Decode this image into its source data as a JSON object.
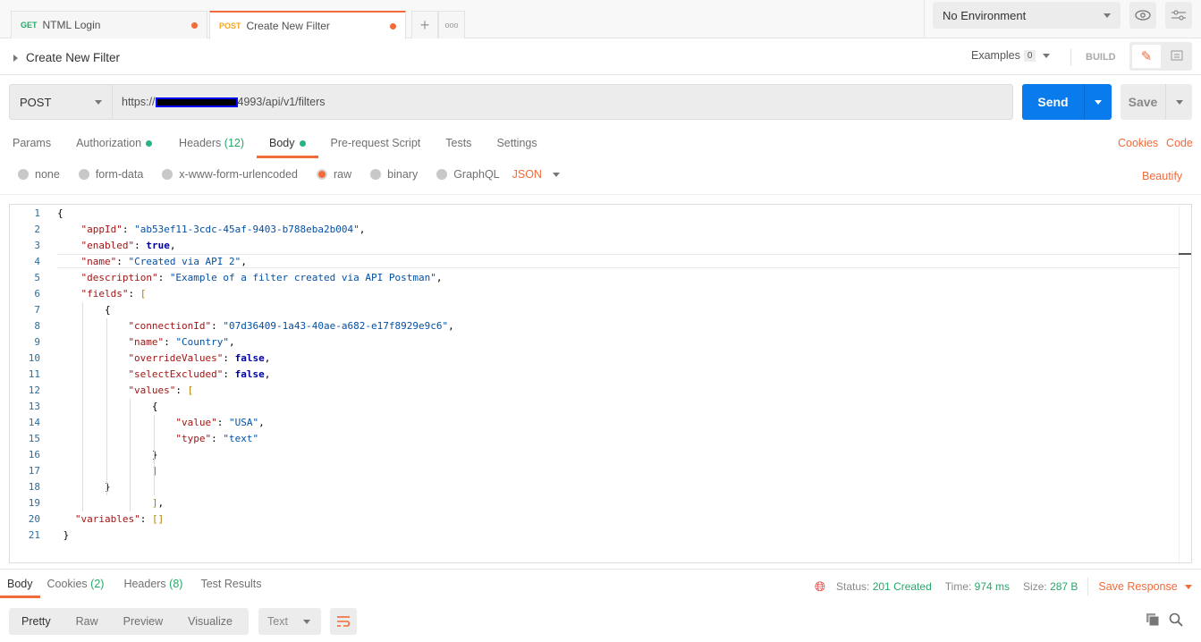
{
  "tabs": [
    {
      "method": "GET",
      "label": "NTML Login",
      "method_color": "#26a86a"
    },
    {
      "method": "POST",
      "label": "Create New Filter",
      "method_color": "#f5a623"
    }
  ],
  "environment": "No Environment",
  "request": {
    "title": "Create New Filter",
    "examples_label": "Examples",
    "examples_count": "0",
    "build_label": "BUILD",
    "method": "POST",
    "url_prefix": "https://",
    "url_suffix": "4993/api/v1/filters",
    "send_label": "Send",
    "save_label": "Save"
  },
  "req_tabs": [
    {
      "label": "Params"
    },
    {
      "label": "Authorization",
      "dot": true
    },
    {
      "label": "Headers",
      "count": "(12)"
    },
    {
      "label": "Body",
      "dot": true,
      "active": true
    },
    {
      "label": "Pre-request Script"
    },
    {
      "label": "Tests"
    },
    {
      "label": "Settings"
    }
  ],
  "links": {
    "cookies": "Cookies",
    "code": "Code",
    "beautify": "Beautify"
  },
  "body_options": [
    {
      "label": "none"
    },
    {
      "label": "form-data"
    },
    {
      "label": "x-www-form-urlencoded"
    },
    {
      "label": "raw",
      "selected": true
    },
    {
      "label": "binary"
    },
    {
      "label": "GraphQL"
    }
  ],
  "body_format": "JSON",
  "code": {
    "lines": [
      {
        "indent": 0,
        "tokens": [
          [
            "p",
            "{"
          ]
        ]
      },
      {
        "indent": 4,
        "tokens": [
          [
            "k",
            "\"appId\""
          ],
          [
            "p",
            ": "
          ],
          [
            "s",
            "\"ab53ef11-3cdc-45af-9403-b788eba2b004\""
          ],
          [
            "p",
            ","
          ]
        ]
      },
      {
        "indent": 4,
        "tokens": [
          [
            "k",
            "\"enabled\""
          ],
          [
            "p",
            ": "
          ],
          [
            "b",
            "true"
          ],
          [
            "p",
            ","
          ]
        ]
      },
      {
        "indent": 4,
        "tokens": [
          [
            "k",
            "\"name\""
          ],
          [
            "p",
            ": "
          ],
          [
            "s",
            "\"Created via API 2\""
          ],
          [
            "p",
            ","
          ]
        ]
      },
      {
        "indent": 4,
        "tokens": [
          [
            "k",
            "\"description\""
          ],
          [
            "p",
            ": "
          ],
          [
            "s",
            "\"Example of a filter created via API Postman\""
          ],
          [
            "p",
            ","
          ]
        ]
      },
      {
        "indent": 4,
        "tokens": [
          [
            "k",
            "\"fields\""
          ],
          [
            "p",
            ": "
          ],
          [
            "br",
            "["
          ]
        ]
      },
      {
        "indent": 8,
        "tokens": [
          [
            "p",
            "{"
          ]
        ]
      },
      {
        "indent": 12,
        "tokens": [
          [
            "k",
            "\"connectionId\""
          ],
          [
            "p",
            ": "
          ],
          [
            "s",
            "\"07d36409-1a43-40ae-a682-e17f8929e9c6\""
          ],
          [
            "p",
            ","
          ]
        ]
      },
      {
        "indent": 12,
        "tokens": [
          [
            "k",
            "\"name\""
          ],
          [
            "p",
            ": "
          ],
          [
            "s",
            "\"Country\""
          ],
          [
            "p",
            ","
          ]
        ]
      },
      {
        "indent": 12,
        "tokens": [
          [
            "k",
            "\"overrideValues\""
          ],
          [
            "p",
            ": "
          ],
          [
            "b",
            "false"
          ],
          [
            "p",
            ","
          ]
        ]
      },
      {
        "indent": 12,
        "tokens": [
          [
            "k",
            "\"selectExcluded\""
          ],
          [
            "p",
            ": "
          ],
          [
            "b",
            "false"
          ],
          [
            "p",
            ","
          ]
        ]
      },
      {
        "indent": 12,
        "tokens": [
          [
            "k",
            "\"values\""
          ],
          [
            "p",
            ": "
          ],
          [
            "br",
            "["
          ]
        ]
      },
      {
        "indent": 16,
        "tokens": [
          [
            "p",
            "{"
          ]
        ]
      },
      {
        "indent": 20,
        "tokens": [
          [
            "k",
            "\"value\""
          ],
          [
            "p",
            ": "
          ],
          [
            "s",
            "\"USA\""
          ],
          [
            "p",
            ","
          ]
        ]
      },
      {
        "indent": 20,
        "tokens": [
          [
            "k",
            "\"type\""
          ],
          [
            "p",
            ": "
          ],
          [
            "s",
            "\"text\""
          ]
        ]
      },
      {
        "indent": 16,
        "tokens": [
          [
            "p",
            "}"
          ]
        ]
      },
      {
        "indent": 16,
        "tokens": [
          [
            "br",
            "]"
          ]
        ]
      },
      {
        "indent": 8,
        "tokens": [
          [
            "p",
            "}"
          ]
        ]
      },
      {
        "indent": 16,
        "tokens": [
          [
            "br",
            "]"
          ],
          [
            "p",
            ","
          ]
        ]
      },
      {
        "indent": 3,
        "tokens": [
          [
            "k",
            "\"variables\""
          ],
          [
            "p",
            ": "
          ],
          [
            "br",
            "[]"
          ]
        ]
      },
      {
        "indent": 1,
        "tokens": [
          [
            "p",
            "}"
          ]
        ]
      }
    ]
  },
  "response": {
    "tabs": [
      {
        "label": "Body",
        "active": true
      },
      {
        "label": "Cookies",
        "count": "(2)"
      },
      {
        "label": "Headers",
        "count": "(8)"
      },
      {
        "label": "Test Results"
      }
    ],
    "status_label": "Status:",
    "status": "201 Created",
    "time_label": "Time:",
    "time": "974 ms",
    "size_label": "Size:",
    "size": "287 B",
    "save_response": "Save Response",
    "views": [
      "Pretty",
      "Raw",
      "Preview",
      "Visualize"
    ],
    "format": "Text"
  }
}
